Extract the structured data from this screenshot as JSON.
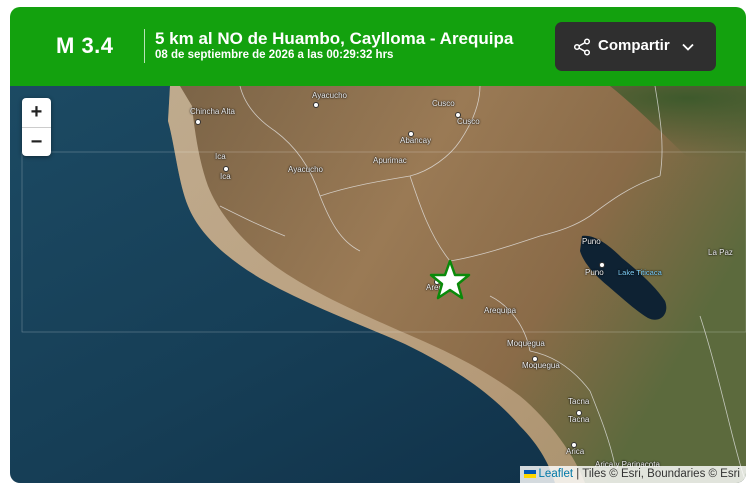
{
  "event": {
    "magnitude": "M 3.4",
    "location": "5 km al NO de Huambo, Caylloma - Arequipa",
    "datetime": "08 de septiembre de 2026 a las 00:29:32 hrs"
  },
  "share": {
    "label": "Compartir",
    "icon": "share-icon"
  },
  "zoom": {
    "in": "+",
    "out": "−"
  },
  "attribution": {
    "leaflet": "Leaflet",
    "rest": " | Tiles © Esri, Boundaries © Esri"
  },
  "colors": {
    "header": "#13a10e",
    "share_bg": "#2f2f2f",
    "star_fill": "#ffffff",
    "star_stroke": "#0a8a0a"
  },
  "map_labels": [
    {
      "text": "Chincha Alta",
      "kind": "city"
    },
    {
      "text": "Ayacucho",
      "kind": "city"
    },
    {
      "text": "Cusco",
      "kind": "region"
    },
    {
      "text": "Cusco",
      "kind": "city"
    },
    {
      "text": "Abancay",
      "kind": "city"
    },
    {
      "text": "Ica",
      "kind": "region"
    },
    {
      "text": "Ica",
      "kind": "city"
    },
    {
      "text": "Ayacucho",
      "kind": "region"
    },
    {
      "text": "Apurimac",
      "kind": "region"
    },
    {
      "text": "Puno",
      "kind": "region"
    },
    {
      "text": "Puno",
      "kind": "city"
    },
    {
      "text": "Lake Titicaca",
      "kind": "water"
    },
    {
      "text": "La Paz",
      "kind": "region"
    },
    {
      "text": "Arequipa",
      "kind": "city"
    },
    {
      "text": "Arequipa",
      "kind": "region"
    },
    {
      "text": "Moquegua",
      "kind": "region"
    },
    {
      "text": "Moquegua",
      "kind": "city"
    },
    {
      "text": "Tacna",
      "kind": "region"
    },
    {
      "text": "Tacna",
      "kind": "city"
    },
    {
      "text": "Arica",
      "kind": "city"
    },
    {
      "text": "Arica y Parinacota",
      "kind": "region"
    }
  ]
}
